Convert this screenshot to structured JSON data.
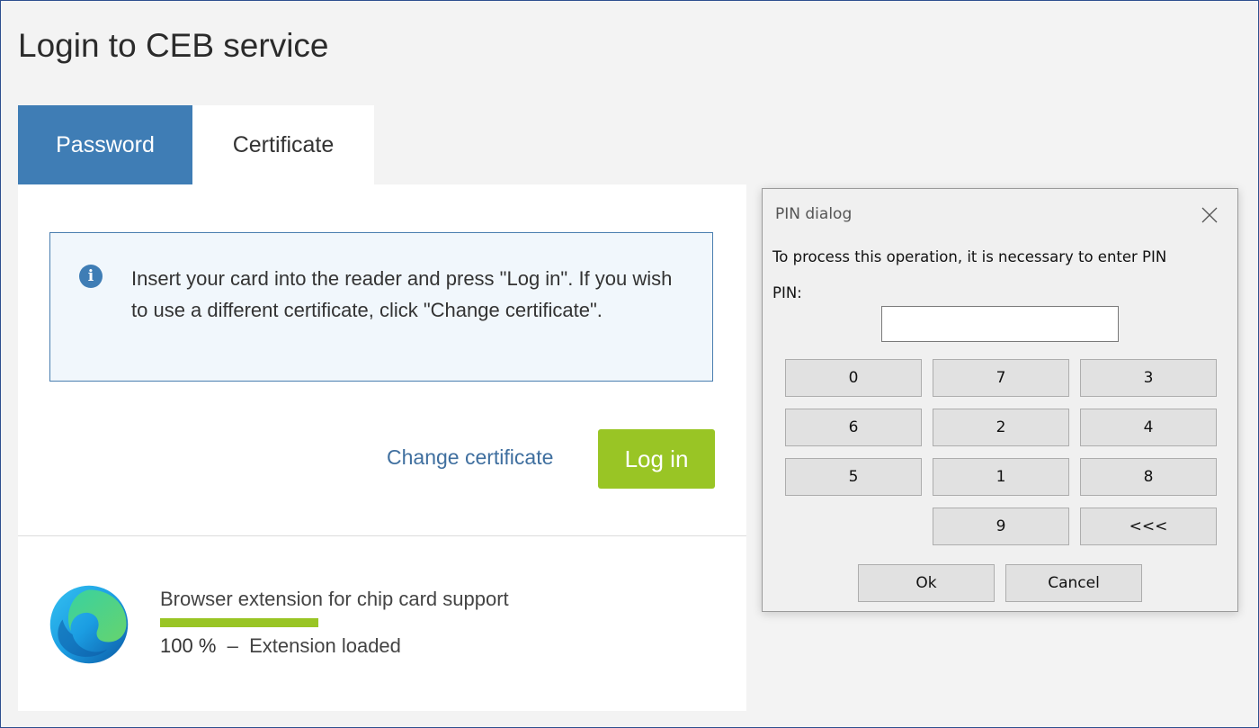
{
  "page": {
    "title": "Login to CEB service"
  },
  "tabs": [
    {
      "label": "Password",
      "active": true
    },
    {
      "label": "Certificate",
      "active": false
    }
  ],
  "info": {
    "icon": "info-icon",
    "text": "Insert your card into the reader and press \"Log in\". If you wish to use a different certificate, click \"Change certificate\"."
  },
  "actions": {
    "change_certificate": "Change certificate",
    "log_in": "Log in"
  },
  "extension": {
    "icon": "edge-browser-icon",
    "name": "Browser extension for chip card support",
    "progress_percent": 100,
    "percent_label": "100 %",
    "separator": "–",
    "status": "Extension loaded"
  },
  "pin_dialog": {
    "title": "PIN dialog",
    "message": "To process this operation, it is necessary to enter PIN",
    "pin_label": "PIN:",
    "pin_value": "",
    "keys": [
      "0",
      "7",
      "3",
      "6",
      "2",
      "4",
      "5",
      "1",
      "8",
      "9",
      "<<<"
    ],
    "ok": "Ok",
    "cancel": "Cancel"
  },
  "colors": {
    "accent_blue": "#3f7db5",
    "login_green": "#99c525",
    "link_blue": "#3f6f9f"
  }
}
